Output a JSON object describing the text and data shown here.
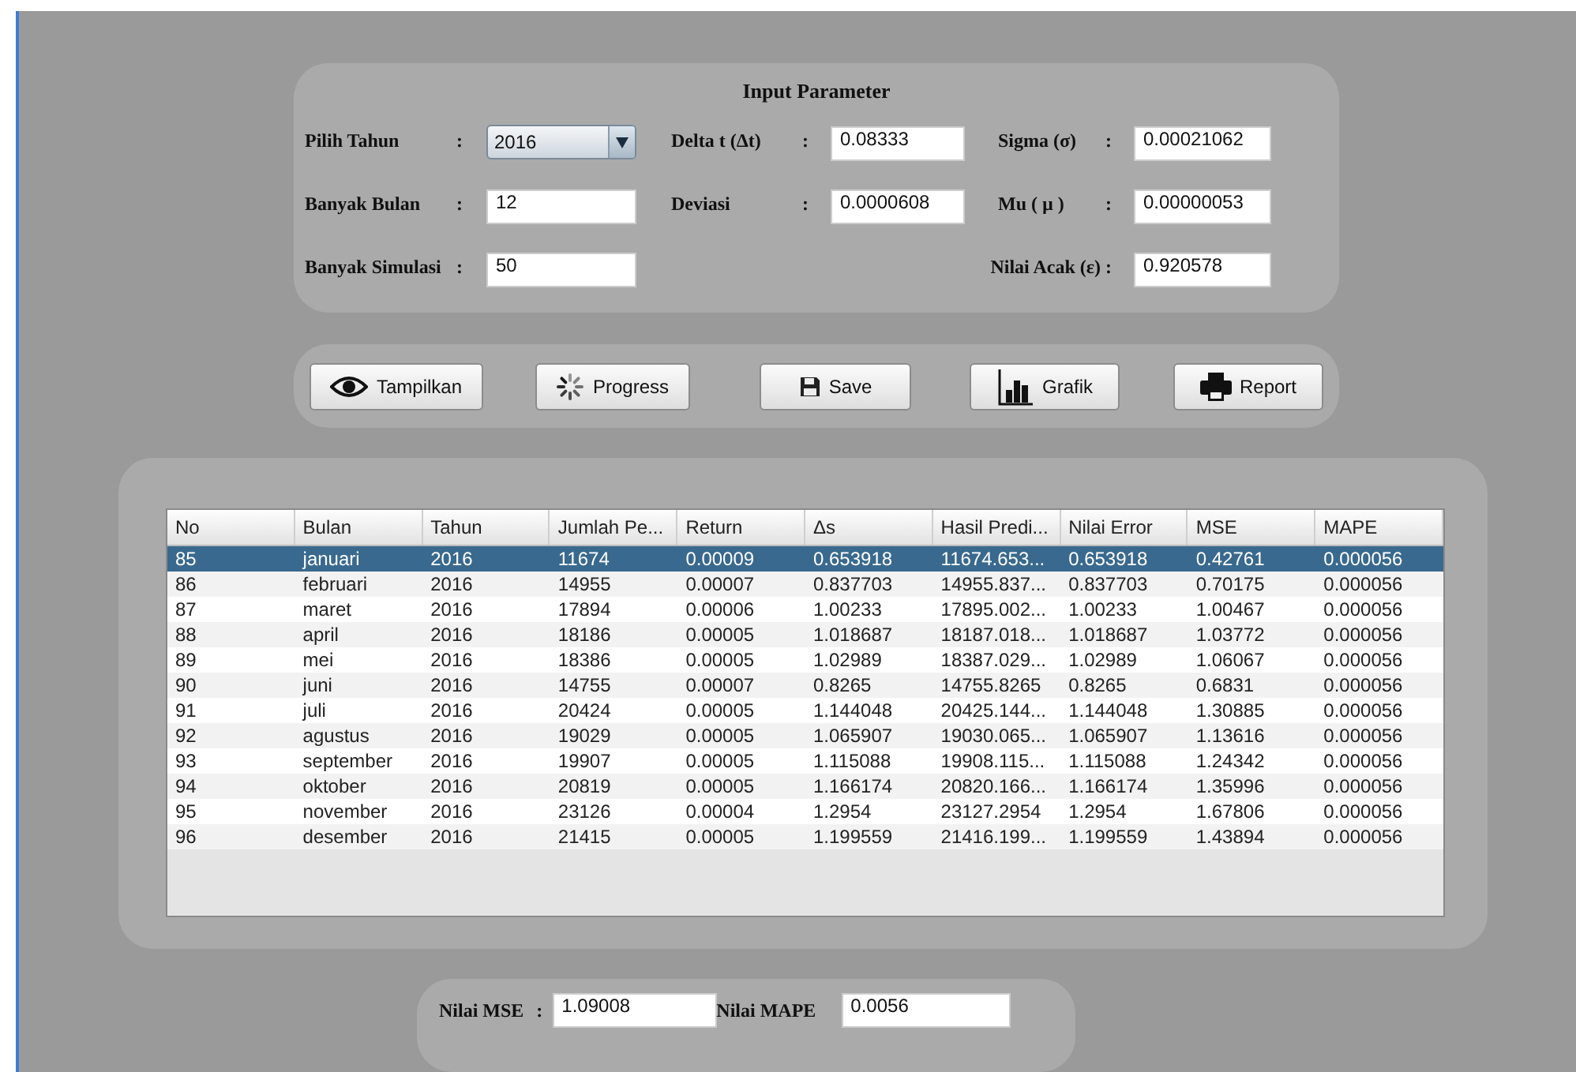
{
  "input_parameter": {
    "title": "Input Parameter",
    "columns": [
      {
        "fields": [
          {
            "kind": "combo",
            "label": "Pilih Tahun",
            "separator": ":",
            "value": "2016"
          },
          {
            "kind": "text",
            "label": "Banyak Bulan",
            "separator": ":",
            "value": "12"
          },
          {
            "kind": "text",
            "label": "Banyak Simulasi",
            "separator": ":",
            "value": "50"
          }
        ]
      },
      {
        "fields": [
          {
            "kind": "text",
            "label": "Delta t  (Δt)",
            "separator": ":",
            "value": "0.08333"
          },
          {
            "kind": "text",
            "label": "Deviasi",
            "separator": ":",
            "value": "0.0000608"
          }
        ]
      },
      {
        "fields": [
          {
            "kind": "text",
            "label": "Sigma  (σ)",
            "separator": ":",
            "value": "0.00021062"
          },
          {
            "kind": "text",
            "label": "Mu ( µ )",
            "separator": ":",
            "value": "0.00000053"
          },
          {
            "kind": "text",
            "label": "Nilai Acak  (ε)",
            "separator": ":",
            "value": "0.920578"
          }
        ]
      }
    ]
  },
  "buttons": [
    {
      "kind": "eye",
      "label": "Tampilkan"
    },
    {
      "kind": "spinner",
      "label": "Progress"
    },
    {
      "kind": "save",
      "label": "Save"
    },
    {
      "kind": "chart",
      "label": "Grafik"
    },
    {
      "kind": "print",
      "label": "Report"
    }
  ],
  "table": {
    "columns": [
      "No",
      "Bulan",
      "Tahun",
      "Jumlah Pe...",
      "Return",
      "Δs",
      "Hasil Predi...",
      "Nilai Error",
      "MSE",
      "MAPE"
    ],
    "rows": [
      {
        "selected": true,
        "cells": [
          "85",
          "januari",
          "2016",
          "11674",
          "0.00009",
          "0.653918",
          "11674.653...",
          "0.653918",
          "0.42761",
          "0.000056"
        ]
      },
      {
        "selected": false,
        "cells": [
          "86",
          "februari",
          "2016",
          "14955",
          "0.00007",
          "0.837703",
          "14955.837...",
          "0.837703",
          "0.70175",
          "0.000056"
        ]
      },
      {
        "selected": false,
        "cells": [
          "87",
          "maret",
          "2016",
          "17894",
          "0.00006",
          "1.00233",
          "17895.002...",
          "1.00233",
          "1.00467",
          "0.000056"
        ]
      },
      {
        "selected": false,
        "cells": [
          "88",
          "april",
          "2016",
          "18186",
          "0.00005",
          "1.018687",
          "18187.018...",
          "1.018687",
          "1.03772",
          "0.000056"
        ]
      },
      {
        "selected": false,
        "cells": [
          "89",
          "mei",
          "2016",
          "18386",
          "0.00005",
          "1.02989",
          "18387.029...",
          "1.02989",
          "1.06067",
          "0.000056"
        ]
      },
      {
        "selected": false,
        "cells": [
          "90",
          "juni",
          "2016",
          "14755",
          "0.00007",
          "0.8265",
          "14755.8265",
          "0.8265",
          "0.6831",
          "0.000056"
        ]
      },
      {
        "selected": false,
        "cells": [
          "91",
          "juli",
          "2016",
          "20424",
          "0.00005",
          "1.144048",
          "20425.144...",
          "1.144048",
          "1.30885",
          "0.000056"
        ]
      },
      {
        "selected": false,
        "cells": [
          "92",
          "agustus",
          "2016",
          "19029",
          "0.00005",
          "1.065907",
          "19030.065...",
          "1.065907",
          "1.13616",
          "0.000056"
        ]
      },
      {
        "selected": false,
        "cells": [
          "93",
          "september",
          "2016",
          "19907",
          "0.00005",
          "1.115088",
          "19908.115...",
          "1.115088",
          "1.24342",
          "0.000056"
        ]
      },
      {
        "selected": false,
        "cells": [
          "94",
          "oktober",
          "2016",
          "20819",
          "0.00005",
          "1.166174",
          "20820.166...",
          "1.166174",
          "1.35996",
          "0.000056"
        ]
      },
      {
        "selected": false,
        "cells": [
          "95",
          "november",
          "2016",
          "23126",
          "0.00004",
          "1.2954",
          "23127.2954",
          "1.2954",
          "1.67806",
          "0.000056"
        ]
      },
      {
        "selected": false,
        "cells": [
          "96",
          "desember",
          "2016",
          "21415",
          "0.00005",
          "1.199559",
          "21416.199...",
          "1.199559",
          "1.43894",
          "0.000056"
        ]
      }
    ]
  },
  "results": [
    {
      "label": "Nilai MSE",
      "separator": ":",
      "value": "1.09008"
    },
    {
      "label": "Nilai MAPE",
      "value": "0.0056"
    }
  ]
}
